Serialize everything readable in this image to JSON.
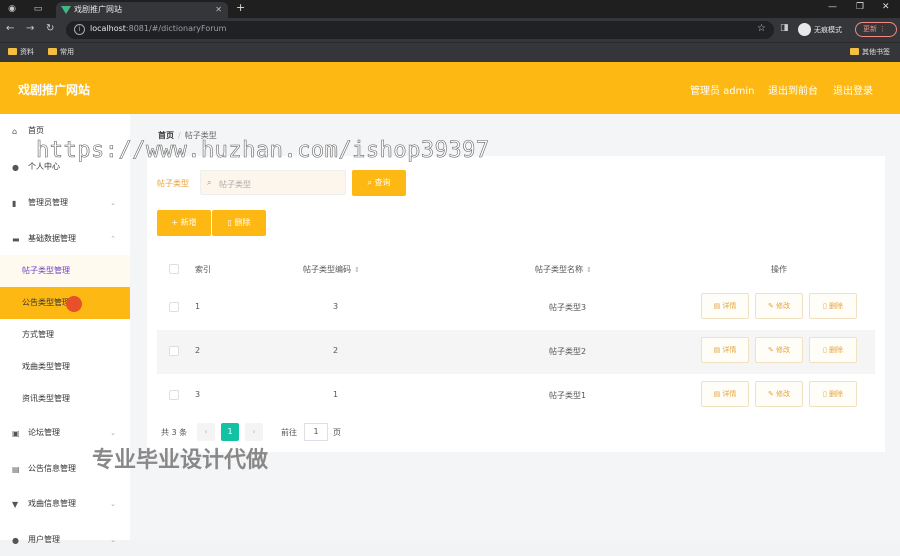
{
  "browser": {
    "tab_title": "戏剧推广网站",
    "url_host": "localhost",
    "url_rest": ":8081/#/dictionaryForum",
    "incognito_label": "无痕模式",
    "update_label": "更新",
    "bookmarks": [
      "资料",
      "常用"
    ],
    "other_bookmarks": "其他书签"
  },
  "header": {
    "title": "戏剧推广网站",
    "admin": "管理员 admin",
    "back_to_front": "退出到前台",
    "logout": "退出登录"
  },
  "sidebar": {
    "items": [
      {
        "label": "首页",
        "icon": "home-icon"
      },
      {
        "label": "个人中心",
        "icon": "user-icon"
      },
      {
        "label": "管理员管理",
        "icon": "chart-icon"
      },
      {
        "label": "基础数据管理",
        "icon": "grid-icon"
      }
    ],
    "subitems": [
      "帖子类型管理",
      "公告类型管理",
      "方式管理",
      "戏曲类型管理",
      "资讯类型管理"
    ],
    "items_after": [
      {
        "label": "论坛管理",
        "icon": "forum-icon"
      },
      {
        "label": "公告信息管理",
        "icon": "notice-icon"
      },
      {
        "label": "戏曲信息管理",
        "icon": "opera-icon"
      },
      {
        "label": "用户管理",
        "icon": "users-icon"
      }
    ]
  },
  "breadcrumb": {
    "home": "首页",
    "sep": "/",
    "current": "帖子类型"
  },
  "search": {
    "label": "帖子类型",
    "placeholder": "帖子类型",
    "button": "查询"
  },
  "actions": {
    "add": "新增",
    "delete": "删除"
  },
  "table": {
    "headers": {
      "index": "索引",
      "code": "帖子类型编码",
      "name": "帖子类型名称",
      "ops": "操作"
    },
    "rows": [
      {
        "index": "1",
        "code": "3",
        "name": "帖子类型3"
      },
      {
        "index": "2",
        "code": "2",
        "name": "帖子类型2"
      },
      {
        "index": "3",
        "code": "1",
        "name": "帖子类型1"
      }
    ],
    "op_labels": {
      "detail": "详情",
      "edit": "修改",
      "delete": "删除"
    }
  },
  "pagination": {
    "total": "共 3 条",
    "current": "1",
    "goto": "前往",
    "page_value": "1",
    "page_unit": "页"
  },
  "overlays": {
    "watermark": "https://www.huzhan.com/ishop39397",
    "promo": "专业毕业设计代做"
  },
  "colors": {
    "accent": "#fdb813",
    "active_sub": "#6f42c1",
    "pager_current": "#13c2a4"
  }
}
